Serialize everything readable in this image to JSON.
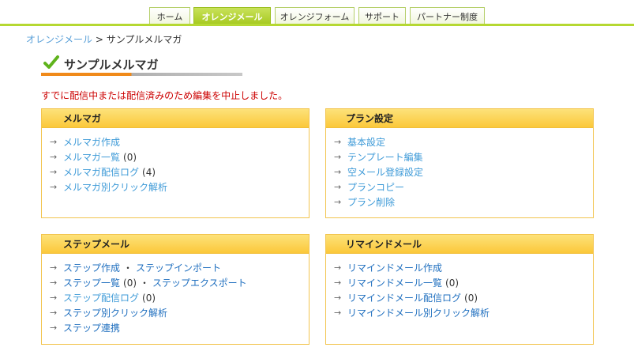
{
  "nav": {
    "tabs": [
      {
        "label": "ホーム",
        "active": false
      },
      {
        "label": "オレンジメール",
        "active": true
      },
      {
        "label": "オレンジフォーム",
        "active": false
      },
      {
        "label": "サポート",
        "active": false
      },
      {
        "label": "パートナー制度",
        "active": false
      }
    ]
  },
  "breadcrumb": {
    "parent": "オレンジメール",
    "separator": ">",
    "current": "サンプルメルマガ"
  },
  "page": {
    "title": "サンプルメルマガ",
    "error": "すでに配信中または配信済みのため編集を中止しました。"
  },
  "colors": {
    "accent": "#b5d832",
    "link": "#3f9bd8",
    "error": "#cc0000",
    "panel_header": "#fbc83a"
  },
  "panels": {
    "melmaga": {
      "title": "メルマガ",
      "items": [
        {
          "label": "メルマガ作成"
        },
        {
          "label": "メルマガ一覧",
          "count": "(0)"
        },
        {
          "label": "メルマガ配信ログ",
          "count": "(4)"
        },
        {
          "label": "メルマガ別クリック解析"
        }
      ]
    },
    "plan": {
      "title": "プラン設定",
      "items": [
        {
          "label": "基本設定"
        },
        {
          "label": "テンプレート編集"
        },
        {
          "label": "空メール登録設定"
        },
        {
          "label": "プランコピー"
        },
        {
          "label": "プラン削除"
        }
      ]
    },
    "step": {
      "title": "ステップメール",
      "items": [
        {
          "label": "ステップ作成",
          "sep": "・",
          "label2": "ステップインポート"
        },
        {
          "label": "ステップ一覧",
          "count": "(0)",
          "sep": "・",
          "label2": "ステップエクスポート"
        },
        {
          "label": "ステップ配信ログ",
          "count": "(0)"
        },
        {
          "label": "ステップ別クリック解析"
        },
        {
          "label": "ステップ連携"
        }
      ]
    },
    "remind": {
      "title": "リマインドメール",
      "items": [
        {
          "label": "リマインドメール作成"
        },
        {
          "label": "リマインドメール一覧",
          "count": "(0)"
        },
        {
          "label": "リマインドメール配信ログ",
          "count": "(0)"
        },
        {
          "label": "リマインドメール別クリック解析"
        }
      ]
    }
  }
}
